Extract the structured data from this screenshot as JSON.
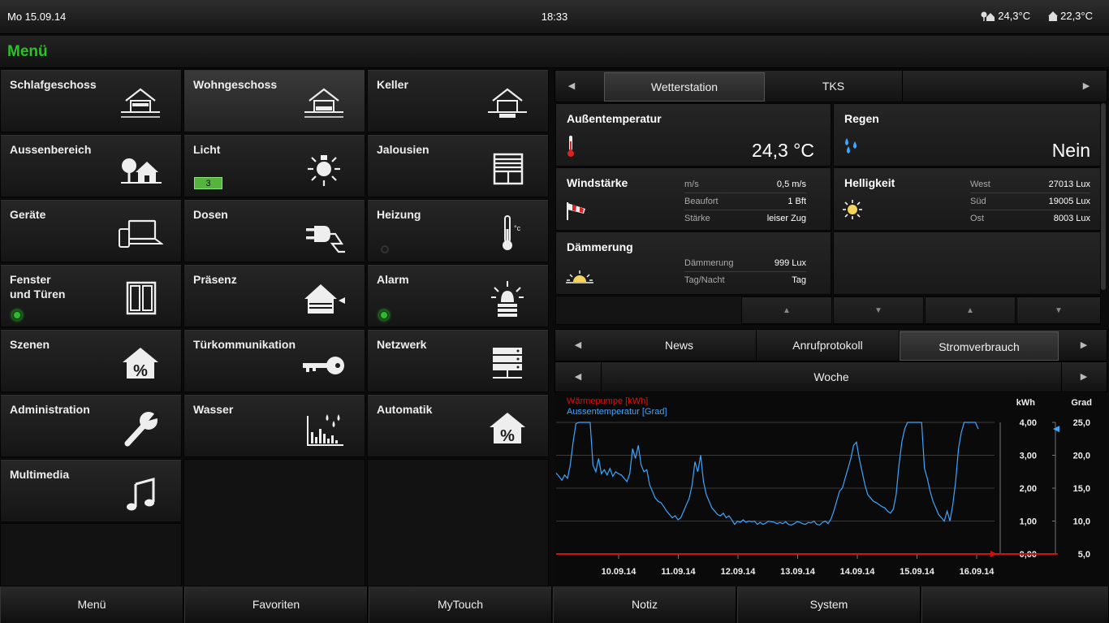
{
  "top": {
    "date": "Mo 15.09.14",
    "time": "18:33",
    "outdoor_temp": "24,3°C",
    "indoor_temp": "22,3°C"
  },
  "menu_title": "Menü",
  "tiles": [
    {
      "label": "Schlafgeschoss",
      "icon": "house-floor-icon"
    },
    {
      "label": "Wohngeschoss",
      "icon": "house-floor-icon"
    },
    {
      "label": "Keller",
      "icon": "house-floor-icon"
    },
    {
      "label": "Aussenbereich",
      "icon": "tree-house-icon"
    },
    {
      "label": "Licht",
      "icon": "lightbulb-icon",
      "badge": "3"
    },
    {
      "label": "Jalousien",
      "icon": "blinds-icon"
    },
    {
      "label": "Geräte",
      "icon": "devices-icon"
    },
    {
      "label": "Dosen",
      "icon": "plug-icon"
    },
    {
      "label": "Heizung",
      "icon": "thermometer-icon"
    },
    {
      "label": "Fenster\nund Türen",
      "icon": "window-icon"
    },
    {
      "label": "Präsenz",
      "icon": "presence-icon"
    },
    {
      "label": "Alarm",
      "icon": "alarm-icon"
    },
    {
      "label": "Szenen",
      "icon": "scene-house-icon"
    },
    {
      "label": "Türkommunikation",
      "icon": "key-icon"
    },
    {
      "label": "Netzwerk",
      "icon": "server-icon"
    },
    {
      "label": "Administration",
      "icon": "wrench-icon"
    },
    {
      "label": "Wasser",
      "icon": "water-chart-icon"
    },
    {
      "label": "Automatik",
      "icon": "automatic-house-icon"
    },
    {
      "label": "Multimedia",
      "icon": "music-note-icon"
    }
  ],
  "weather_tabs": [
    "Wetterstation",
    "TKS"
  ],
  "weather": {
    "outside": {
      "title": "Außentemperatur",
      "value": "24,3 °C"
    },
    "rain": {
      "title": "Regen",
      "value": "Nein"
    },
    "wind": {
      "title": "Windstärke",
      "rows": [
        {
          "k": "m/s",
          "v": "0,5 m/s"
        },
        {
          "k": "Beaufort",
          "v": "1 Bft"
        },
        {
          "k": "Stärke",
          "v": "leiser Zug"
        }
      ]
    },
    "bright": {
      "title": "Helligkeit",
      "rows": [
        {
          "k": "West",
          "v": "27013 Lux"
        },
        {
          "k": "Süd",
          "v": "19005 Lux"
        },
        {
          "k": "Ost",
          "v": "8003 Lux"
        }
      ]
    },
    "dusk": {
      "title": "Dämmerung",
      "rows": [
        {
          "k": "Dämmerung",
          "v": "999 Lux"
        },
        {
          "k": "Tag/Nacht",
          "v": "Tag"
        }
      ]
    }
  },
  "info_tabs": [
    "News",
    "Anrufprotokoll",
    "Stromverbrauch"
  ],
  "period": "Woche",
  "bottom_nav": [
    "Menü",
    "Favoriten",
    "MyTouch",
    "Notiz",
    "System"
  ],
  "colors": {
    "accent": "#2bc12b",
    "series_power": "#d11111",
    "series_temp": "#3da6ff"
  },
  "chart_data": {
    "type": "line",
    "legend": [
      "Wärmepumpe [kWh]",
      "Aussentemperatur [Grad]"
    ],
    "x_ticks": [
      "10.09.14",
      "11.09.14",
      "12.09.14",
      "13.09.14",
      "14.09.14",
      "15.09.14",
      "16.09.14"
    ],
    "y_left_label": "kWh",
    "y_left_ticks": [
      "4,00",
      "3,00",
      "2,00",
      "1,00",
      "0,00"
    ],
    "y_left_range": [
      0,
      4
    ],
    "y_right_label": "Grad",
    "y_right_ticks": [
      "25,0",
      "20,0",
      "15,0",
      "10,0",
      "5,0"
    ],
    "y_right_range": [
      5,
      25
    ],
    "series": [
      {
        "name": "Wärmepumpe [kWh]",
        "values": [
          0,
          0,
          0,
          0,
          0,
          0,
          0,
          0,
          0,
          0,
          0,
          0,
          0,
          0,
          0,
          0,
          0,
          0,
          0,
          0,
          0,
          0,
          0,
          0,
          0,
          0,
          0,
          0,
          0,
          0,
          0,
          0,
          0,
          0,
          0,
          0,
          0,
          0,
          0,
          0,
          0,
          0,
          0,
          0,
          0,
          0,
          0,
          0,
          0,
          0,
          0,
          0,
          0,
          0,
          0,
          0,
          0,
          0,
          0,
          0,
          0,
          0,
          0,
          0,
          0,
          0,
          0,
          0,
          0,
          0,
          0,
          0,
          0,
          0,
          0,
          0,
          0,
          0,
          0,
          0,
          0,
          0,
          0,
          0,
          0,
          0,
          0,
          0,
          0,
          0,
          0,
          0,
          0,
          0,
          0,
          0,
          0,
          0,
          0,
          0,
          0,
          0,
          0,
          0,
          0,
          0,
          0,
          0,
          0,
          0,
          0,
          0,
          0,
          0,
          0,
          0,
          0,
          0,
          0,
          0,
          0,
          0,
          0,
          0,
          0,
          0,
          0,
          0,
          0,
          0,
          0,
          0,
          0,
          0,
          0,
          0,
          0,
          0,
          0,
          0,
          0,
          0,
          0,
          0,
          0,
          0,
          0,
          0,
          0,
          0,
          0,
          0,
          0,
          0,
          0,
          0,
          0,
          0,
          0,
          0,
          0,
          0,
          0,
          0,
          0,
          0,
          0,
          0,
          0,
          0,
          0,
          0,
          0,
          0,
          0,
          0,
          0,
          0
        ]
      },
      {
        "name": "Aussentemperatur [Grad]",
        "values": [
          17.3,
          16.8,
          16.2,
          17.0,
          16.5,
          18.5,
          22.0,
          24.8,
          25.0,
          25.0,
          25.0,
          25.0,
          25.0,
          18.5,
          17.5,
          19.5,
          17.2,
          17.8,
          17.0,
          18.0,
          16.8,
          17.5,
          17.2,
          17.0,
          16.5,
          16.0,
          17.2,
          21.0,
          19.5,
          21.5,
          18.5,
          17.5,
          17.8,
          15.5,
          14.5,
          13.5,
          13.0,
          12.8,
          12.2,
          11.5,
          11.0,
          10.5,
          10.8,
          10.2,
          10.5,
          11.5,
          12.5,
          13.5,
          15.5,
          19.0,
          17.5,
          20.0,
          16.0,
          14.0,
          13.0,
          12.0,
          11.5,
          11.0,
          10.8,
          11.2,
          10.5,
          10.8,
          10.2,
          9.5,
          10.0,
          9.8,
          10.2,
          9.8,
          10.0,
          9.9,
          10.0,
          9.5,
          9.8,
          9.5,
          9.7,
          10.0,
          9.9,
          9.8,
          9.6,
          9.8,
          9.6,
          9.9,
          9.5,
          9.4,
          9.6,
          9.9,
          9.8,
          9.6,
          9.5,
          9.8,
          9.7,
          10.0,
          9.5,
          9.4,
          9.8,
          10.0,
          9.6,
          10.3,
          11.5,
          13.0,
          14.5,
          15.0,
          16.5,
          18.0,
          19.5,
          21.5,
          22.0,
          19.5,
          17.5,
          15.5,
          14.0,
          13.5,
          13.0,
          12.8,
          12.5,
          12.2,
          12.0,
          11.5,
          11.2,
          11.8,
          14.0,
          18.5,
          22.0,
          24.0,
          25.0,
          25.0,
          25.0,
          25.0,
          25.0,
          25.0,
          18.0,
          16.5,
          14.5,
          13.0,
          12.0,
          11.0,
          10.5,
          10.0,
          11.5,
          10.0,
          12.5,
          16.0,
          21.0,
          23.5,
          25.0,
          25.0,
          25.0,
          25.0,
          25.0,
          24.0
        ]
      }
    ]
  }
}
